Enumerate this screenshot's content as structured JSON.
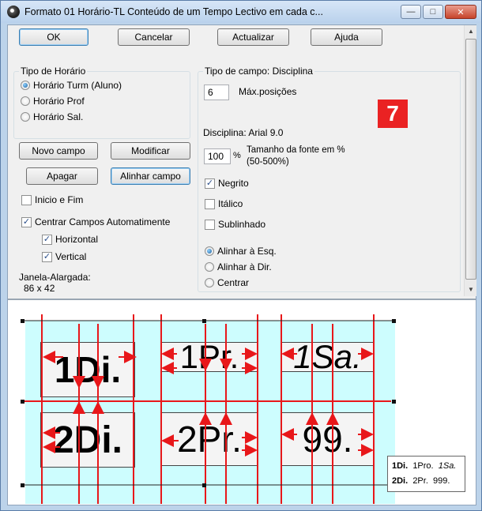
{
  "window": {
    "title": "Formato 01  Horário-TL  Conteúdo de um Tempo Lectivo em cada c..."
  },
  "toolbar": {
    "ok": "OK",
    "cancel": "Cancelar",
    "update": "Actualizar",
    "help": "Ajuda"
  },
  "schedule_type": {
    "label": "Tipo de Horário",
    "options": [
      "Horário Turm (Aluno)",
      "Horário Prof",
      "Horário Sal."
    ],
    "selected": "Horário Turm (Aluno)"
  },
  "field_buttons": {
    "new": "Novo campo",
    "modify": "Modificar",
    "delete": "Apagar",
    "align": "Alinhar campo"
  },
  "options": {
    "start_end": {
      "label": "Inicio e Fim",
      "checked": false
    },
    "auto_center": {
      "label": "Centrar Campos Automatimente",
      "checked": true
    },
    "horizontal": {
      "label": "Horizontal",
      "checked": true
    },
    "vertical": {
      "label": "Vertical",
      "checked": true
    }
  },
  "window_size": {
    "label": "Janela-Alargada:",
    "value": "86 x  42"
  },
  "field_type": {
    "label": "Tipo de campo: Disciplina",
    "max_positions_value": "6",
    "max_positions_label": "Máx.posições",
    "font_info": "Disciplina: Arial 9.0",
    "font_size_value": "100",
    "percent": "%",
    "font_size_label_1": "Tamanho da fonte em %",
    "font_size_label_2": "(50-500%)",
    "bold": {
      "label": "Negrito",
      "checked": true
    },
    "italic": {
      "label": "Itálico",
      "checked": false
    },
    "underline": {
      "label": "Sublinhado",
      "checked": false
    },
    "alignment": {
      "options": [
        "Alinhar à Esq.",
        "Alinhar à Dir.",
        "Centrar"
      ],
      "selected": "Alinhar à Esq."
    }
  },
  "badge": "7",
  "preview": {
    "cells": {
      "r1c1": "1Di.",
      "r1c2": "1Pr.",
      "r1c3": "1Sa.",
      "r2c1": "2Di.",
      "r2c2": "2Pr.",
      "r2c3": "99."
    },
    "legend": {
      "row1": {
        "a": "1Di.",
        "b": "1Pro.",
        "c": "1Sa."
      },
      "row2": {
        "a": "2Di.",
        "b": "2Pr.",
        "c": "999."
      }
    }
  },
  "colors": {
    "guide_red": "#e8171a",
    "preview_cyan": "#cdfdfe",
    "badge_red": "#ea2223"
  }
}
